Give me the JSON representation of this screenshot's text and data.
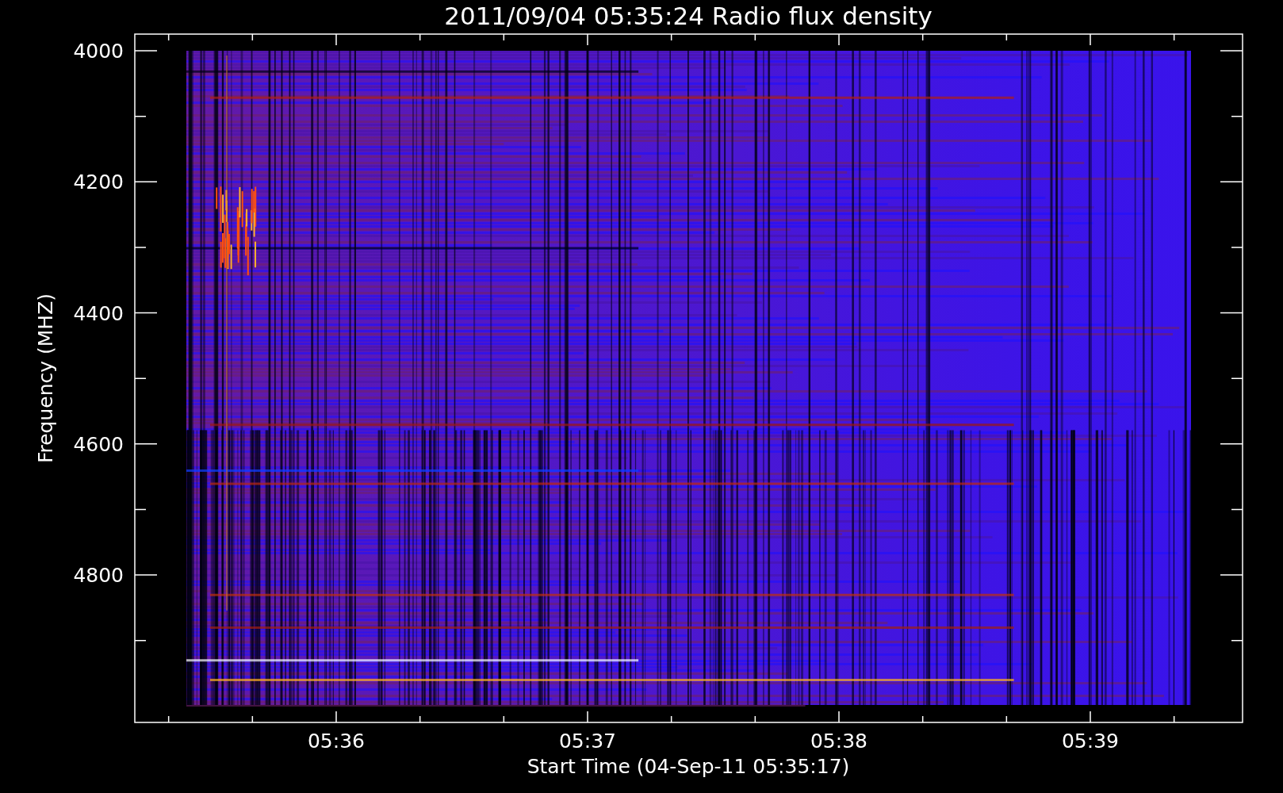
{
  "plot": {
    "title": "2011/09/04 05:35:24 Radio flux density",
    "ylabel": "Frequency (MHZ)",
    "xlabel": "Start Time (04-Sep-11 05:35:17)",
    "y_tick_labels": [
      "4000",
      "4200",
      "4400",
      "4600",
      "4800"
    ],
    "x_tick_labels": [
      "05:36",
      "05:37",
      "05:38",
      "05:39"
    ]
  }
}
